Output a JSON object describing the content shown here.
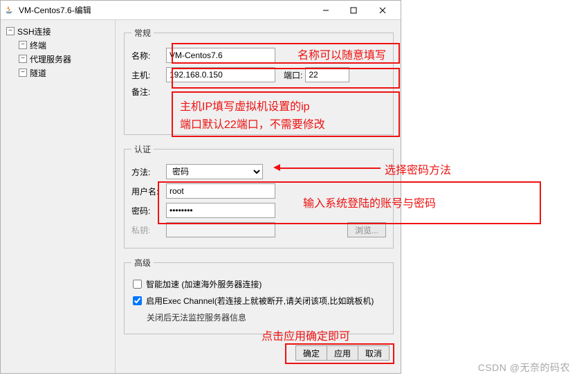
{
  "title": "VM-Centos7.6-编辑",
  "sidebar": {
    "root": "SSH连接",
    "items": [
      {
        "label": "终端"
      },
      {
        "label": "代理服务器"
      },
      {
        "label": "隧道"
      }
    ]
  },
  "general": {
    "legend": "常规",
    "name_label": "名称:",
    "name_value": "VM-Centos7.6",
    "host_label": "主机:",
    "host_value": "192.168.0.150",
    "port_label": "端口:",
    "port_value": "22",
    "note_label": "备注:",
    "note_value": ""
  },
  "auth": {
    "legend": "认证",
    "method_label": "方法:",
    "method_value": "密码",
    "user_label": "用户名:",
    "user_value": "root",
    "pass_label": "密码:",
    "pass_value": "********",
    "key_label": "私钥:",
    "key_value": "",
    "browse_label": "浏览..."
  },
  "advanced": {
    "legend": "高级",
    "accel_label": "智能加速 (加速海外服务器连接)",
    "accel_checked": false,
    "exec_label": "启用Exec Channel(若连接上就被断开,请关闭该项,比如跳板机)",
    "exec_checked": true,
    "exec_note": "关闭后无法监控服务器信息"
  },
  "buttons": {
    "ok": "确定",
    "apply": "应用",
    "cancel": "取消"
  },
  "annotations": {
    "name_hint": "名称可以随意填写",
    "host_hint_line1": "主机IP填写虚拟机设置的ip",
    "host_hint_line2": "端口默认22端口，不需要修改",
    "method_hint": "选择密码方法",
    "userpass_hint": "输入系统登陆的账号与密码",
    "button_hint": "点击应用确定即可"
  },
  "watermark": "CSDN @无奈的码农"
}
